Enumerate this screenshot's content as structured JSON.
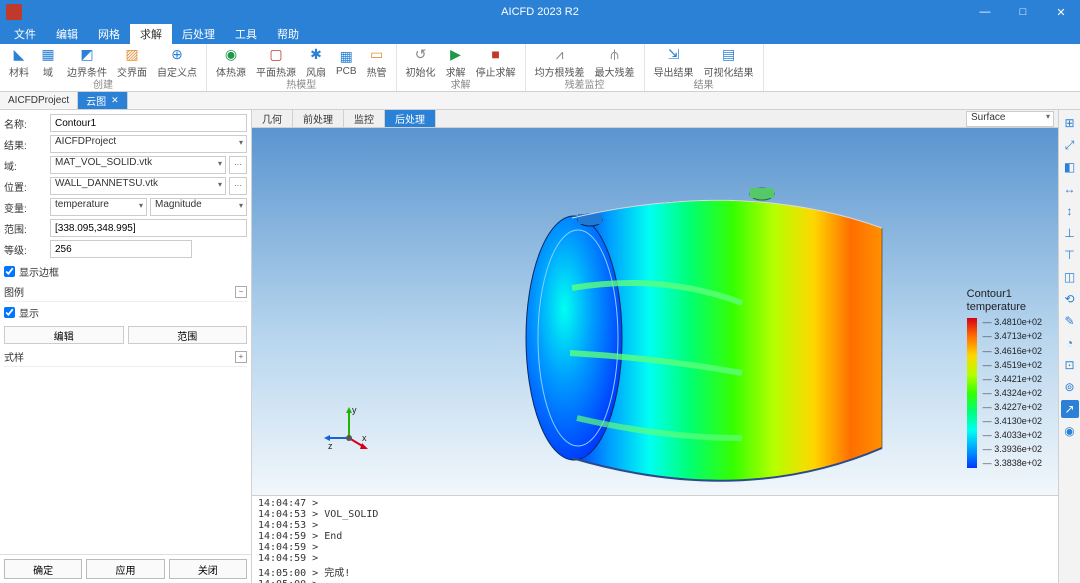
{
  "app": {
    "title": "AICFD 2023 R2"
  },
  "menu": [
    "文件",
    "编辑",
    "网格",
    "求解",
    "后处理",
    "工具",
    "帮助"
  ],
  "menu_active": 3,
  "ribbon_groups": [
    {
      "name": "创建",
      "buttons": [
        {
          "label": "材料",
          "icon": "◣",
          "color": "#2b81d6"
        },
        {
          "label": "域",
          "icon": "▦",
          "color": "#2b81d6"
        },
        {
          "label": "边界条件",
          "icon": "◩",
          "color": "#2b81d6"
        },
        {
          "label": "交界面",
          "icon": "▨",
          "color": "#e58f3a"
        },
        {
          "label": "自定义点",
          "icon": "⊕",
          "color": "#2b81d6"
        }
      ]
    },
    {
      "name": "热模型",
      "buttons": [
        {
          "label": "体热源",
          "icon": "◉",
          "color": "#1e984b"
        },
        {
          "label": "平面热源",
          "icon": "▢",
          "color": "#c0392b"
        },
        {
          "label": "风扇",
          "icon": "✱",
          "color": "#2b81d6"
        },
        {
          "label": "PCB",
          "icon": "▦",
          "color": "#2b81d6"
        },
        {
          "label": "热管",
          "icon": "▭",
          "color": "#e58f3a"
        }
      ]
    },
    {
      "name": "求解",
      "buttons": [
        {
          "label": "初始化",
          "icon": "↺",
          "color": "#888"
        },
        {
          "label": "求解",
          "icon": "▶",
          "color": "#1e984b"
        },
        {
          "label": "停止求解",
          "icon": "■",
          "color": "#c0392b"
        }
      ]
    },
    {
      "name": "残差监控",
      "buttons": [
        {
          "label": "均方根残差",
          "icon": "⩘",
          "color": "#888"
        },
        {
          "label": "最大残差",
          "icon": "⫛",
          "color": "#888"
        }
      ]
    },
    {
      "name": "结果",
      "buttons": [
        {
          "label": "导出结果",
          "icon": "⇲",
          "color": "#2b81d6"
        },
        {
          "label": "可视化结果",
          "icon": "▤",
          "color": "#2b81d6"
        }
      ]
    }
  ],
  "project_tabs": [
    {
      "label": "AICFDProject",
      "active": false
    },
    {
      "label": "云图",
      "active": true,
      "closable": true
    }
  ],
  "props": {
    "name_label": "名称:",
    "name_value": "Contour1",
    "result_label": "结果:",
    "result_value": "AICFDProject",
    "domain_label": "域:",
    "domain_value": "MAT_VOL_SOLID.vtk",
    "location_label": "位置:",
    "location_value": "WALL_DANNETSU.vtk",
    "variable_label": "变量:",
    "variable_value": "temperature",
    "mag": "Magnitude",
    "range_label": "范围:",
    "range_value": "[338.095,348.995]",
    "levels_label": "等级:",
    "levels_value": "256",
    "show_edge": "显示边框",
    "legend_section": "图例",
    "show_legend": "显示",
    "edit_btn": "编辑",
    "range_btn": "范围",
    "style_section": "式样"
  },
  "bottom_buttons": [
    "确定",
    "应用",
    "关闭"
  ],
  "view_tabs": [
    "几何",
    "前处理",
    "监控",
    "后处理"
  ],
  "view_tab_active": 3,
  "view_mode": "Surface",
  "legend": {
    "title1": "Contour1",
    "title2": "temperature",
    "values": [
      "3.4810e+02",
      "3.4713e+02",
      "3.4616e+02",
      "3.4519e+02",
      "3.4421e+02",
      "3.4324e+02",
      "3.4227e+02",
      "3.4130e+02",
      "3.4033e+02",
      "3.3936e+02",
      "3.3838e+02"
    ]
  },
  "console_lines": [
    "14:04:47 >",
    "14:04:53 > VOL_SOLID",
    "14:04:53 >",
    "14:04:59 > End",
    "14:04:59 >",
    "14:04:59 >",
    "14:05:00 > 完成!",
    "14:05:00 >"
  ],
  "sidebar_tools": [
    "⊞",
    "⤢",
    "◧",
    "↔",
    "↕",
    "⊥",
    "⊤",
    "◫",
    "⟲",
    "✎",
    "◔",
    "⊡",
    "⊚",
    "↗",
    "◉"
  ],
  "sidebar_active": 13
}
